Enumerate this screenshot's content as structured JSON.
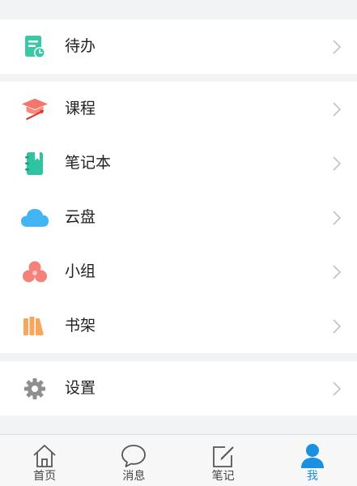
{
  "groups": [
    {
      "items": [
        {
          "label": "待办",
          "icon": "todo-clock-icon",
          "color": "#3cc7a6"
        }
      ]
    },
    {
      "items": [
        {
          "label": "课程",
          "icon": "graduation-cap-icon",
          "color": "#f2766c"
        },
        {
          "label": "笔记本",
          "icon": "notebook-icon",
          "color": "#2fc3a2"
        },
        {
          "label": "云盘",
          "icon": "cloud-icon",
          "color": "#43b4f4"
        },
        {
          "label": "小组",
          "icon": "group-circles-icon",
          "color": "#f4827a"
        },
        {
          "label": "书架",
          "icon": "bookshelf-icon",
          "color": "#f7a65d"
        }
      ]
    },
    {
      "items": [
        {
          "label": "设置",
          "icon": "gear-icon",
          "color": "#8f8f8f"
        }
      ]
    }
  ],
  "tabbar": {
    "tabs": [
      {
        "label": "首页",
        "icon": "home-icon",
        "active": false
      },
      {
        "label": "消息",
        "icon": "message-bubble-icon",
        "active": false
      },
      {
        "label": "笔记",
        "icon": "edit-note-icon",
        "active": false
      },
      {
        "label": "我",
        "icon": "person-icon",
        "active": true
      }
    ],
    "active_color": "#1a90e0",
    "inactive_color": "#444444"
  }
}
